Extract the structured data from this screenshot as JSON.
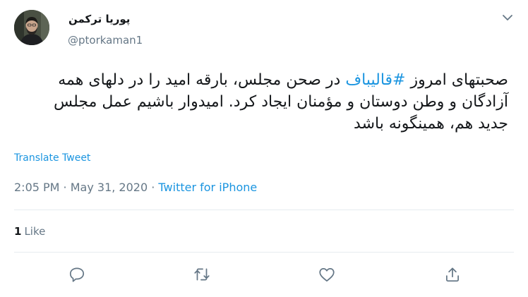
{
  "author": {
    "display_name": "پوریا ترکمن",
    "handle": "@ptorkaman1"
  },
  "tweet": {
    "text_before": "صحبتهای امروز ",
    "hashtag": "#قالیباف",
    "text_after": " در صحن مجلس، بارقه امید را در دلهای همه آزادگان و وطن دوستان و مؤمنان ایجاد کرد. امیدوار باشیم عمل مجلس جدید هم، همینگونه باشد"
  },
  "translate_label": "Translate Tweet",
  "meta": {
    "time": "2:05 PM",
    "separator": " · ",
    "date": "May 31, 2020",
    "source": "Twitter for iPhone"
  },
  "stats": {
    "likes_count": "1",
    "likes_label": "Like"
  },
  "icons": {
    "menu": "chevron-down-icon",
    "reply": "reply-icon",
    "retweet": "retweet-icon",
    "like": "heart-icon",
    "share": "share-icon"
  },
  "colors": {
    "accent": "#1b95e0",
    "text": "#14171a",
    "secondary": "#657786",
    "divider": "#e6ecf0"
  }
}
